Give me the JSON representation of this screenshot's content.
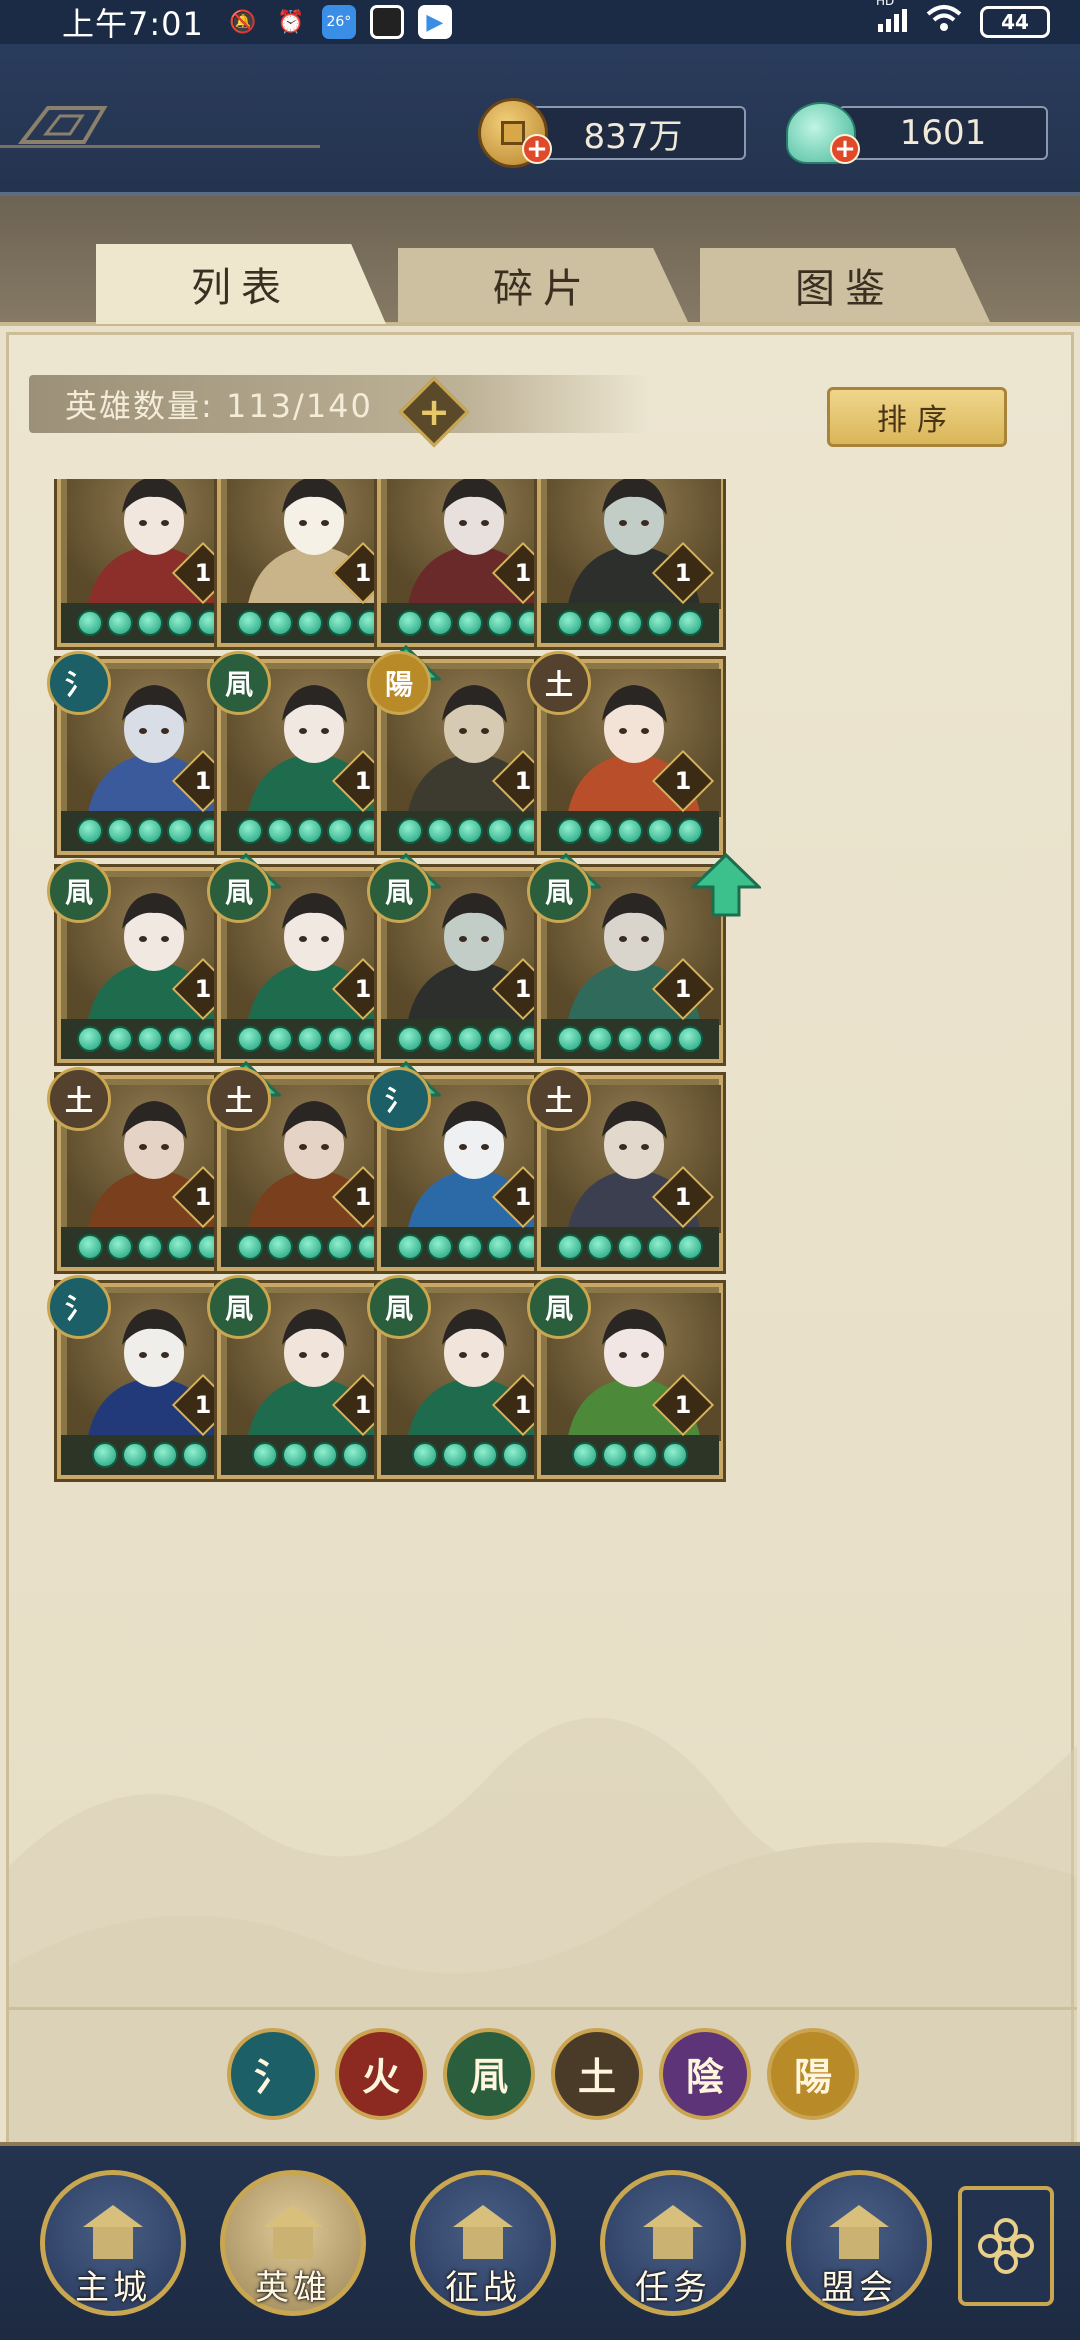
{
  "status_bar": {
    "time": "上午7:01",
    "temp_badge": "26°",
    "battery": "44",
    "network": "HD"
  },
  "currencies": [
    {
      "name": "coins",
      "value": "837万"
    },
    {
      "name": "shells",
      "value": "1601"
    }
  ],
  "tabs": [
    {
      "label": "列表",
      "active": true
    },
    {
      "label": "碎片",
      "active": false
    },
    {
      "label": "图鉴",
      "active": false
    }
  ],
  "hero_count": {
    "label": "英雄数量: 113/140",
    "current": 113,
    "max": 140
  },
  "sort_label": "排序",
  "heroes": [
    {
      "element": "",
      "element_class": "",
      "level": "1",
      "stars": 5,
      "upgrade": false,
      "palette": [
        "#8c2f2a",
        "#f1e7de"
      ]
    },
    {
      "element": "",
      "element_class": "",
      "level": "1",
      "stars": 5,
      "upgrade": false,
      "palette": [
        "#c9b48a",
        "#f5f1e6"
      ]
    },
    {
      "element": "",
      "element_class": "",
      "level": "1",
      "stars": 5,
      "upgrade": false,
      "palette": [
        "#6a2a2a",
        "#e7e0dc"
      ]
    },
    {
      "element": "",
      "element_class": "",
      "level": "1",
      "stars": 5,
      "upgrade": false,
      "palette": [
        "#2c2f2c",
        "#c2cdc8"
      ]
    },
    {
      "element": "氵",
      "element_class": "el-water",
      "level": "1",
      "stars": 5,
      "upgrade": false,
      "palette": [
        "#3a5a9c",
        "#d8dde6"
      ]
    },
    {
      "element": "凬",
      "element_class": "el-wind",
      "level": "1",
      "stars": 5,
      "upgrade": true,
      "palette": [
        "#1f6b4e",
        "#f1e8e2"
      ]
    },
    {
      "element": "陽",
      "element_class": "el-yang",
      "level": "1",
      "stars": 5,
      "upgrade": false,
      "palette": [
        "#3d3a30",
        "#d6cbb2"
      ]
    },
    {
      "element": "土",
      "element_class": "el-earth",
      "level": "1",
      "stars": 5,
      "upgrade": false,
      "palette": [
        "#b84f2a",
        "#f3e3d6"
      ]
    },
    {
      "element": "凬",
      "element_class": "el-wind",
      "level": "1",
      "stars": 5,
      "upgrade": true,
      "palette": [
        "#1f6b4e",
        "#f1e8e2"
      ]
    },
    {
      "element": "凬",
      "element_class": "el-wind",
      "level": "1",
      "stars": 5,
      "upgrade": true,
      "palette": [
        "#1f6b4e",
        "#f1e8e2"
      ]
    },
    {
      "element": "凬",
      "element_class": "el-wind",
      "level": "1",
      "stars": 5,
      "upgrade": true,
      "palette": [
        "#2c2f2c",
        "#c2cdc8"
      ]
    },
    {
      "element": "凬",
      "element_class": "el-wind",
      "level": "1",
      "stars": 5,
      "upgrade": true,
      "palette": [
        "#2f6a5a",
        "#d9d4cc"
      ]
    },
    {
      "element": "土",
      "element_class": "el-earth",
      "level": "1",
      "stars": 5,
      "upgrade": true,
      "palette": [
        "#7a3f1c",
        "#e5d4c6"
      ]
    },
    {
      "element": "土",
      "element_class": "el-earth",
      "level": "1",
      "stars": 5,
      "upgrade": true,
      "palette": [
        "#7a3f1c",
        "#e5d4c6"
      ]
    },
    {
      "element": "氵",
      "element_class": "el-water",
      "level": "1",
      "stars": 5,
      "upgrade": false,
      "palette": [
        "#2b6aa6",
        "#eef0f2"
      ]
    },
    {
      "element": "土",
      "element_class": "el-earth",
      "level": "1",
      "stars": 5,
      "upgrade": false,
      "palette": [
        "#3b3f4f",
        "#e2d9cc"
      ]
    },
    {
      "element": "氵",
      "element_class": "el-water",
      "level": "1",
      "stars": 4,
      "upgrade": false,
      "palette": [
        "#223a7a",
        "#f0eeea"
      ]
    },
    {
      "element": "凬",
      "element_class": "el-wind",
      "level": "1",
      "stars": 4,
      "upgrade": false,
      "palette": [
        "#1f6b4e",
        "#f1e4da"
      ]
    },
    {
      "element": "凬",
      "element_class": "el-wind",
      "level": "1",
      "stars": 4,
      "upgrade": false,
      "palette": [
        "#1f6b4e",
        "#f1e4da"
      ]
    },
    {
      "element": "凬",
      "element_class": "el-wind",
      "level": "1",
      "stars": 4,
      "upgrade": false,
      "palette": [
        "#4c8a3a",
        "#f2e6e4"
      ]
    }
  ],
  "element_filters": [
    {
      "glyph": "氵",
      "name": "water",
      "color": "#1d5f66"
    },
    {
      "glyph": "火",
      "name": "fire",
      "color": "#8c2a22"
    },
    {
      "glyph": "凬",
      "name": "wind",
      "color": "#2b5e3d"
    },
    {
      "glyph": "土",
      "name": "earth",
      "color": "#4a3a28"
    },
    {
      "glyph": "陰",
      "name": "yin",
      "color": "#5e3478"
    },
    {
      "glyph": "陽",
      "name": "yang",
      "color": "#b88a28"
    }
  ],
  "nav": [
    {
      "label": "主城",
      "icon": "palace-icon",
      "active": false
    },
    {
      "label": "英雄",
      "icon": "hero-portrait-icon",
      "active": true
    },
    {
      "label": "征战",
      "icon": "campaign-icon",
      "active": false
    },
    {
      "label": "任务",
      "icon": "task-scroll-icon",
      "active": false
    },
    {
      "label": "盟会",
      "icon": "alliance-gate-icon",
      "active": false
    }
  ]
}
